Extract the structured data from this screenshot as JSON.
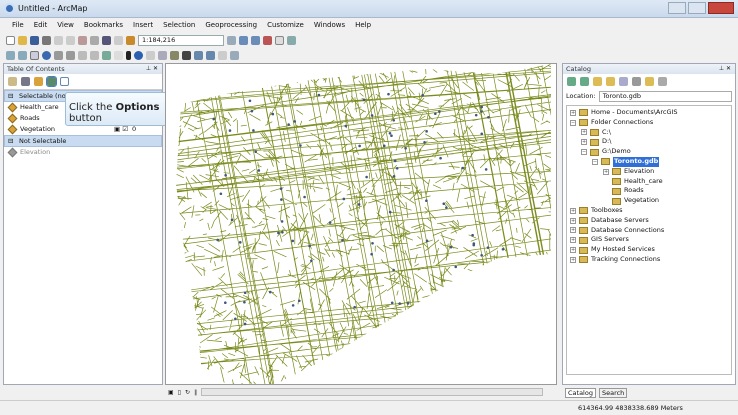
{
  "window": {
    "title": "Untitled - ArcMap"
  },
  "menu": [
    "File",
    "Edit",
    "View",
    "Bookmarks",
    "Insert",
    "Selection",
    "Geoprocessing",
    "Customize",
    "Windows",
    "Help"
  ],
  "toolbar": {
    "scale": "1:184,216"
  },
  "toc": {
    "title": "Table Of Contents",
    "groups": [
      {
        "label": "Selectable (no f",
        "layers": [
          "Health_care",
          "Roads",
          "Vegetation"
        ],
        "count": "0"
      },
      {
        "label": "Not Selectable",
        "layers": [
          "Elevation"
        ]
      }
    ]
  },
  "tooltip": {
    "prefix": "Click the ",
    "bold": "Options",
    "suffix": " button"
  },
  "catalog": {
    "title": "Catalog",
    "location_label": "Location:",
    "location_value": "Toronto.gdb",
    "tree": [
      {
        "label": "Home - Documents\\ArcGIS",
        "level": 0
      },
      {
        "label": "Folder Connections",
        "level": 0
      },
      {
        "label": "C:\\",
        "level": 1
      },
      {
        "label": "D:\\",
        "level": 1
      },
      {
        "label": "G:\\Demo",
        "level": 1
      },
      {
        "label": "Toronto.gdb",
        "level": 2,
        "selected": true
      },
      {
        "label": "Elevation",
        "level": 3
      },
      {
        "label": "Health_care",
        "level": 3
      },
      {
        "label": "Roads",
        "level": 3
      },
      {
        "label": "Vegetation",
        "level": 3
      },
      {
        "label": "Toolboxes",
        "level": 0
      },
      {
        "label": "Database Servers",
        "level": 0
      },
      {
        "label": "Database Connections",
        "level": 0
      },
      {
        "label": "GIS Servers",
        "level": 0
      },
      {
        "label": "My Hosted Services",
        "level": 0
      },
      {
        "label": "Tracking Connections",
        "level": 0
      }
    ],
    "tabs": [
      "Catalog",
      "Search"
    ]
  },
  "status": {
    "coords": "614364.99  4838338.689 Meters"
  },
  "colors": {
    "roads": "#7a8a1c",
    "selection": "#2f6fd6",
    "toc_group": "#c8dbf0"
  }
}
